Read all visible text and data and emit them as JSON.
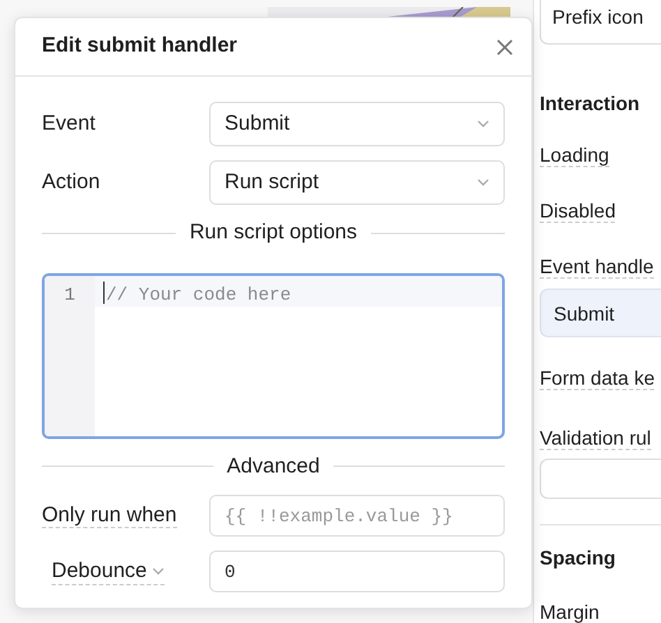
{
  "inspector": {
    "prefix_icon_field": "Prefix icon",
    "interaction": {
      "title": "Interaction",
      "loading": "Loading",
      "disabled": "Disabled",
      "event_handlers": "Event handle",
      "handler": "Submit",
      "form_data_key": "Form data ke",
      "validation_rules": "Validation rul"
    },
    "spacing": {
      "title": "Spacing",
      "margin": "Margin"
    }
  },
  "modal": {
    "title": "Edit submit handler",
    "fields": [
      {
        "label": "Event",
        "kind": "select",
        "value": "Submit"
      },
      {
        "label": "Action",
        "kind": "select",
        "value": "Run script"
      }
    ],
    "script_section": "Run script options",
    "editor": {
      "line_number": "1",
      "placeholder": "// Your code here",
      "focused": true
    },
    "advanced_section": "Advanced",
    "only_run_when": {
      "label": "Only run when",
      "placeholder": "{{ !!example.value }}"
    },
    "debounce": {
      "label": "Debounce",
      "value": "0"
    }
  }
}
